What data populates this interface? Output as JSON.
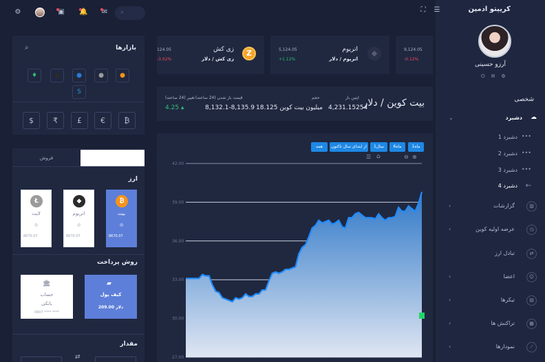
{
  "brand": "کریپتو ادمین",
  "user": {
    "name": "آرزو حسینی"
  },
  "sidebar": {
    "section": "شخصی",
    "dashboard": "دشبرد",
    "subs": [
      "دشبرد 1",
      "دشبرد 2",
      "دشبرد 3",
      "دشبرد 4"
    ],
    "items": [
      "گزارشات",
      "عرضه اولیه کوین",
      "تبادل ارز",
      "اعضا",
      "تیکرها",
      "تراکنش ها",
      "نمودارها"
    ]
  },
  "tickers": [
    {
      "name": "",
      "pair": "",
      "price": "9,124.05",
      "change": "-0.12%",
      "dir": "down"
    },
    {
      "name": "اتریوم",
      "pair": "اتریوم / دلار",
      "price": "5,124.05",
      "change": "+1.12%",
      "dir": "up"
    },
    {
      "name": "زی کش",
      "pair": "زی کش / دلار",
      "price": "124.05",
      "change": "-3.02%",
      "dir": "down"
    }
  ],
  "market": {
    "title": "بیت کوین / دلار",
    "last_price_label": "اپتیں باز",
    "last_price": "4,231.15254",
    "volume_label": "حجم",
    "volume": "18.125 میلیون بیت کوین",
    "range_label": "قیمت باز شدن (24 ساعته)",
    "range": "8,132.1-8,135.9",
    "change_label": "تغییر (24 ساعته)",
    "change": "4.25"
  },
  "ranges": [
    "1ماه",
    "6ماه",
    "1سال",
    "از ابتدای سال تاکنون",
    "همه"
  ],
  "chart_data": {
    "type": "area",
    "y_ticks": [
      "42.00",
      "39.00",
      "36.00",
      "33.00",
      "30.00",
      "27.00"
    ],
    "ylim": [
      27,
      42
    ],
    "values": [
      33.1,
      33.1,
      33.1,
      33.1,
      33.1,
      33.4,
      33.3,
      33.3,
      32.6,
      32.1,
      32.0,
      31.6,
      31.5,
      31.4,
      31.3,
      31.6,
      31.5,
      31.6,
      31.9,
      31.7,
      31.7,
      31.9,
      31.9,
      32.2,
      32.2,
      32.9,
      33.5,
      33.6,
      33.5,
      33.6,
      33.8,
      33.8,
      33.9,
      34.0,
      35.0,
      35.5,
      35.7,
      36.3,
      37.0,
      37.2,
      37.6,
      37.4,
      37.5,
      37.6,
      37.3,
      37.4,
      37.6,
      37.1,
      37.0,
      37.8,
      37.8,
      38.1,
      38.2,
      38.0,
      37.8,
      37.8,
      37.8,
      37.7,
      38.1,
      37.8,
      37.6,
      37.8,
      37.8,
      37.9,
      38.6,
      38.3,
      38.3,
      38.7,
      38.5,
      38.3,
      38.9,
      39.8
    ]
  },
  "markets": {
    "title": "بازارها",
    "currencies": [
      "$",
      "₹",
      "£",
      "€",
      "₿"
    ]
  },
  "trade": {
    "tab_buy": "",
    "tab_sell": "فروش",
    "currency_title": "ارز",
    "coins": [
      {
        "name": "بیت",
        "price": "8670.07",
        "color": "#f7931a",
        "glyph": "₿"
      },
      {
        "name": "اتریوم",
        "price": "8670.07",
        "color": "#2b2b2b",
        "glyph": "◆"
      },
      {
        "name": "لایت",
        "price": "8670.07",
        "color": "#9b9b9b",
        "glyph": "Ł"
      }
    ],
    "payment_title": "روش پرداخت",
    "wallet_label": "کیف پول",
    "wallet_amount": "209.00 دلار",
    "bank_label": "حساب",
    "bank_sub": "بانکی",
    "bank_number": "0807 **** ****",
    "amount_title": "مقدار"
  },
  "colors": {
    "accent": "#1e88e5",
    "up": "#2fbf71",
    "down": "#f44b5b"
  }
}
